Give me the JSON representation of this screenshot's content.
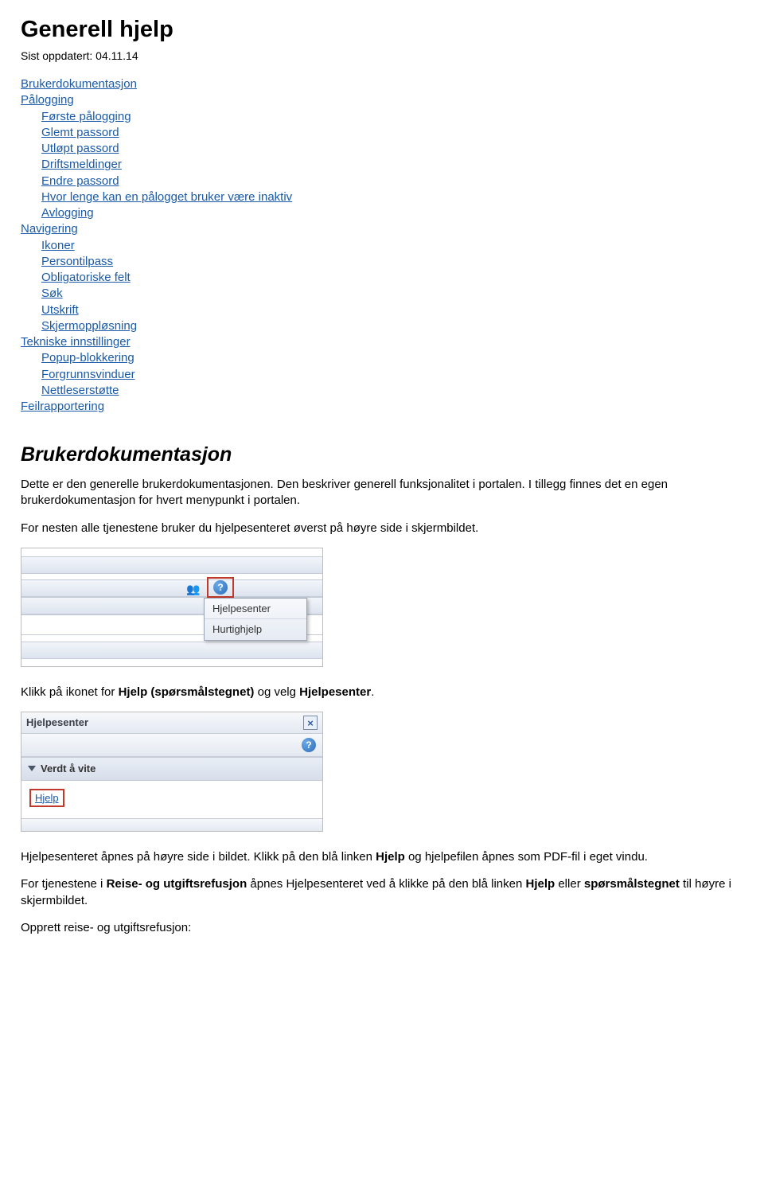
{
  "page": {
    "title": "Generell hjelp",
    "updated": "Sist oppdatert: 04.11.14"
  },
  "toc": {
    "items": [
      {
        "label": "Brukerdokumentasjon",
        "indent": 0
      },
      {
        "label": "Pålogging",
        "indent": 0
      },
      {
        "label": "Første pålogging",
        "indent": 1
      },
      {
        "label": "Glemt passord",
        "indent": 1
      },
      {
        "label": "Utløpt passord",
        "indent": 1
      },
      {
        "label": "Driftsmeldinger",
        "indent": 1
      },
      {
        "label": "Endre passord",
        "indent": 1
      },
      {
        "label": "Hvor lenge kan en pålogget bruker være inaktiv",
        "indent": 1
      },
      {
        "label": "Avlogging",
        "indent": 1
      },
      {
        "label": "Navigering",
        "indent": 0
      },
      {
        "label": "Ikoner",
        "indent": 1
      },
      {
        "label": "Persontilpass",
        "indent": 1
      },
      {
        "label": "Obligatoriske felt",
        "indent": 1
      },
      {
        "label": "Søk",
        "indent": 1
      },
      {
        "label": "Utskrift",
        "indent": 1
      },
      {
        "label": "Skjermoppløsning",
        "indent": 1
      },
      {
        "label": "Tekniske innstillinger",
        "indent": 0
      },
      {
        "label": "Popup-blokkering",
        "indent": 1
      },
      {
        "label": "Forgrunnsvinduer",
        "indent": 1
      },
      {
        "label": "Nettleserstøtte",
        "indent": 1
      },
      {
        "label": "Feilrapportering",
        "indent": 0
      }
    ]
  },
  "section": {
    "heading": "Brukerdokumentasjon",
    "p1": "Dette er den generelle brukerdokumentasjonen. Den beskriver generell funksjonalitet i portalen. I tillegg finnes det en egen brukerdokumentasjon for hvert menypunkt i portalen.",
    "p2": "For nesten alle tjenestene bruker du hjelpesenteret øverst på høyre side i skjermbildet."
  },
  "shot1": {
    "menu": [
      "Hjelpesenter",
      "Hurtighjelp"
    ]
  },
  "after_shot1": {
    "pre": "Klikk på ikonet for ",
    "bold1": "Hjelp (spørsmålstegnet)",
    "mid": " og velg ",
    "bold2": "Hjelpesenter",
    "post": "."
  },
  "shot2": {
    "title": "Hjelpesenter",
    "accordion": "Verdt å vite",
    "link": "Hjelp",
    "close": "×",
    "q": "?"
  },
  "after_shot2": {
    "p1_pre": "Hjelpesenteret åpnes på høyre side i bildet. Klikk på den blå  linken ",
    "p1_bold": "Hjelp",
    "p1_post": " og hjelpefilen åpnes som PDF-fil i eget vindu.",
    "p2_pre": "For tjenestene i ",
    "p2_bold1": "Reise- og utgiftsrefusjon",
    "p2_mid": " åpnes Hjelpesenteret ved å klikke på den blå linken ",
    "p2_bold2": "Hjelp",
    "p2_mid2": " eller ",
    "p2_bold3": "spørsmålstegnet",
    "p2_post": " til høyre i skjermbildet.",
    "p3": "Opprett reise- og utgiftsrefusjon:"
  }
}
